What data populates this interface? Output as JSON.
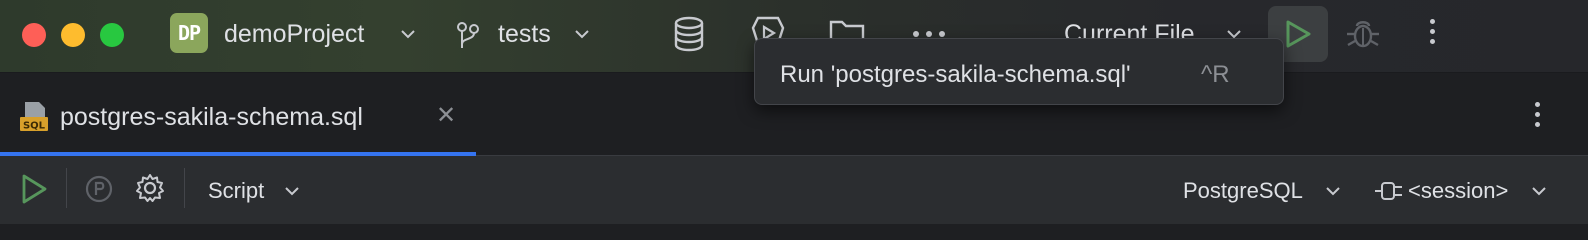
{
  "titlebar": {
    "project_initials": "DP",
    "project_name": "demoProject",
    "branch_name": "tests",
    "run_config": "Current File"
  },
  "tooltip": {
    "text": "Run 'postgres-sakila-schema.sql'",
    "shortcut": "^R"
  },
  "editor_tabs": [
    {
      "label": "postgres-sakila-schema.sql",
      "icon": "sql-file-icon",
      "close_glyph": "✕",
      "active": true
    }
  ],
  "toolbar": {
    "script_label": "Script",
    "dialect_label": "PostgreSQL",
    "session_label": "<session>"
  },
  "colors": {
    "accent": "#3574f0",
    "run_green": "#57965c",
    "project_badge": "#8ba65c",
    "traffic_red": "#fe5f57",
    "traffic_yellow": "#febc2e",
    "traffic_green": "#28c840"
  }
}
